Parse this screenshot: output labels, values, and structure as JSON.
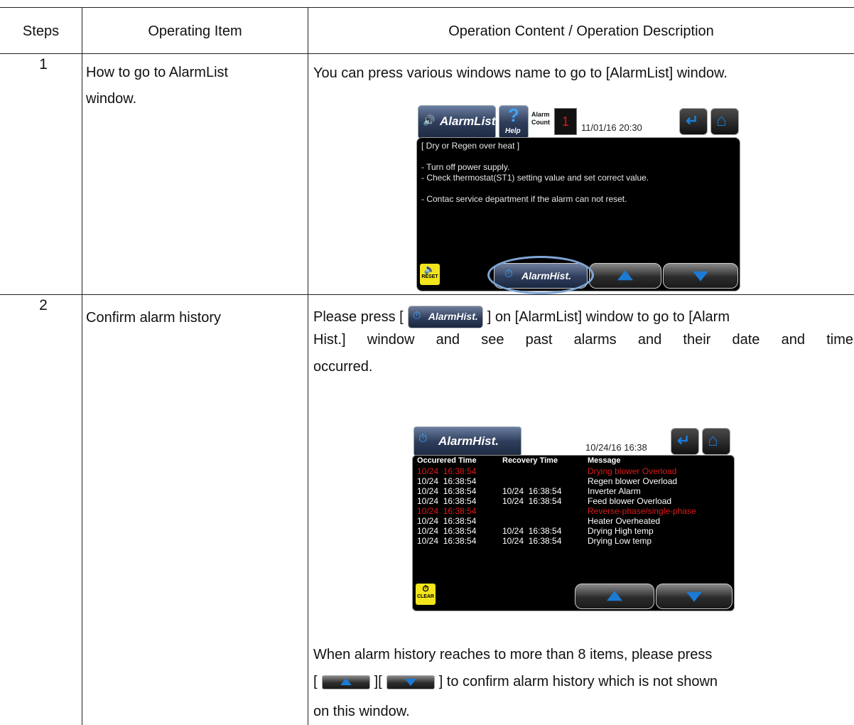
{
  "table": {
    "headers": {
      "steps": "Steps",
      "item": "Operating Item",
      "content": "Operation Content / Operation Description"
    },
    "rows": [
      {
        "step": "1",
        "item_line1": "How to go to AlarmList",
        "item_line2": "window.",
        "desc_line1": "You can press various windows name to go to [AlarmList] window."
      },
      {
        "step": "2",
        "item_line1": "Confirm alarm history",
        "desc_prefix": "Please press [",
        "desc_suffix": "] on [AlarmList] window to go to [Alarm",
        "desc_line2_words": [
          "Hist.]",
          "window",
          "and",
          "see",
          "past",
          "alarms",
          "and",
          "their",
          "date",
          "and",
          "time"
        ],
        "desc_line3": "occurred.",
        "desc_line4": "When alarm history reaches to more than 8 items, please press",
        "desc_line5_open": "[",
        "desc_line5_mid": "][",
        "desc_line5_rest": "] to confirm alarm history which is not shown",
        "desc_line6": "on this window."
      }
    ]
  },
  "alarmlist_screen": {
    "title": "AlarmList",
    "help_label": "Help",
    "alarm_label_1": "Alarm",
    "alarm_label_2": "Count",
    "alarm_count": "1",
    "datetime": "11/01/16 20:30",
    "lines": [
      "[ Dry or Regen over heat ]",
      "",
      "- Turn off power supply.",
      "- Check thermostat(ST1) setting value and set correct value.",
      "",
      "- Contac service department if the alarm can not reset."
    ],
    "reset_label": "RESET",
    "hist_button": "AlarmHist."
  },
  "alarmhist_screen": {
    "title": "AlarmHist.",
    "datetime": "10/24/16 16:38",
    "col_occured": "Occurered Time",
    "col_recovery": "Recovery Time",
    "col_message": "Message",
    "rows": [
      {
        "occ": "10/24  16:38:54",
        "rec": "",
        "msg": "Drying blower Overload",
        "red": true
      },
      {
        "occ": "10/24  16:38:54",
        "rec": "",
        "msg": "Regen blower Overload",
        "red": false
      },
      {
        "occ": "10/24  16:38:54",
        "rec": "10/24  16:38:54",
        "msg": "Inverter Alarm",
        "red": false
      },
      {
        "occ": "10/24  16:38:54",
        "rec": "10/24  16:38:54",
        "msg": "Feed blower Overload",
        "red": false
      },
      {
        "occ": "10/24  16:38:54",
        "rec": "",
        "msg": "Reverse-phase/single-phase",
        "red": true
      },
      {
        "occ": "10/24  16:38:54",
        "rec": "",
        "msg": "Heater Overheated",
        "red": false
      },
      {
        "occ": "10/24  16:38:54",
        "rec": "10/24  16:38:54",
        "msg": "Drying High temp",
        "red": false
      },
      {
        "occ": "10/24  16:38:54",
        "rec": "10/24  16:38:54",
        "msg": "Drying Low temp",
        "red": false
      }
    ],
    "clear_label": "CLEAR"
  },
  "inline_button_label": "AlarmHist.",
  "colors": {
    "alarm_red": "#e01818",
    "arrow_blue": "#1b7bd4",
    "highlight_ring": "#7fa6d6",
    "button_yellow": "#f2e51c"
  }
}
